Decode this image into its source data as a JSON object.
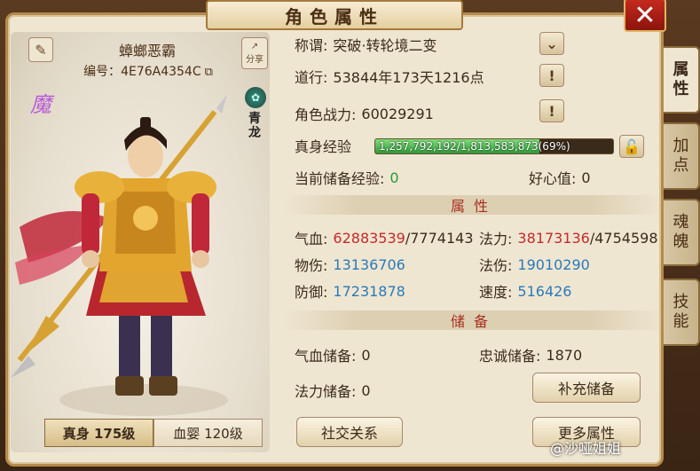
{
  "window": {
    "title": "角色属性",
    "close_label": "✕"
  },
  "character": {
    "name": "蟑螂恶霸",
    "id_label": "编号：",
    "id_value": "4E76A4354C",
    "demon_mark": "魔",
    "faction": "青龙",
    "share_label": "分享"
  },
  "level_tabs": [
    {
      "label": "真身 175级",
      "active": true
    },
    {
      "label": "血婴 120级",
      "active": false
    }
  ],
  "info": {
    "title_label": "称谓:",
    "title_value": "突破·转轮境二变",
    "daoxing_label": "道行:",
    "daoxing_value": "53844年173天1216点",
    "power_label": "角色战力:",
    "power_value": "60029291",
    "exp_label": "真身经验",
    "exp_text": "1,257,792,192/1,813,583,873(69%)",
    "exp_fraction": 0.69,
    "stored_exp_label": "当前储备经验:",
    "stored_exp_value": "0",
    "kindness_label": "好心值:",
    "kindness_value": "0"
  },
  "attributes": {
    "section_title": "属性",
    "hp_label": "气血:",
    "hp_current": "62883539",
    "hp_max": "/7774143",
    "mp_label": "法力:",
    "mp_current": "38173136",
    "mp_max": "/4754598",
    "phys_label": "物伤:",
    "phys_value": "13136706",
    "magic_label": "法伤:",
    "magic_value": "19010290",
    "defense_label": "防御:",
    "defense_value": "17231878",
    "speed_label": "速度:",
    "speed_value": "516426"
  },
  "reserve": {
    "section_title": "储备",
    "hp_reserve_label": "气血储备:",
    "hp_reserve_value": "0",
    "loyalty_label": "忠诚储备:",
    "loyalty_value": "1870",
    "mp_reserve_label": "法力储备:",
    "mp_reserve_value": "0",
    "refill_button": "补充储备"
  },
  "buttons": {
    "social": "社交关系",
    "more_attributes": "更多属性"
  },
  "side_tabs": [
    {
      "label": "属性",
      "active": true
    },
    {
      "label": "加点",
      "active": false
    },
    {
      "label": "魂魄",
      "active": false
    },
    {
      "label": "技能",
      "active": false
    }
  ],
  "watermark": "@沙哑姐姐",
  "colors": {
    "hp_current": "#c42a2a",
    "stat_value": "#2a7ab8",
    "exp_fill": "#2f9a3a",
    "section_title": "#a83020"
  }
}
